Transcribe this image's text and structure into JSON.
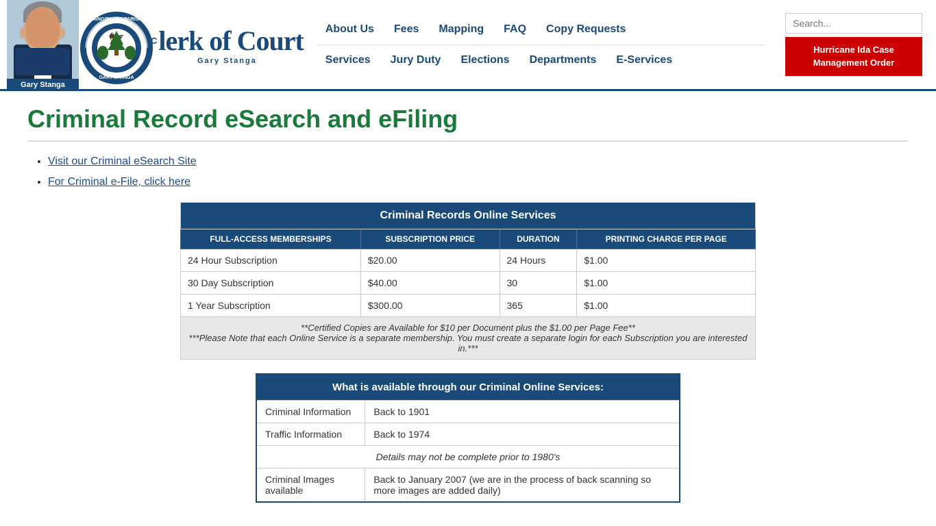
{
  "header": {
    "person_name": "Gary Stanga",
    "seal_text": "TANGIPAHOA\nPARISH",
    "clerk_title": "Clerk of Court",
    "clerk_name": "Gary Stanga",
    "search_placeholder": "Search..."
  },
  "nav": {
    "row1": [
      {
        "label": "About Us",
        "id": "about-us"
      },
      {
        "label": "Fees",
        "id": "fees"
      },
      {
        "label": "Mapping",
        "id": "mapping"
      },
      {
        "label": "FAQ",
        "id": "faq"
      },
      {
        "label": "Copy Requests",
        "id": "copy-requests"
      }
    ],
    "row2": [
      {
        "label": "Services",
        "id": "services"
      },
      {
        "label": "Jury Duty",
        "id": "jury-duty"
      },
      {
        "label": "Elections",
        "id": "elections"
      },
      {
        "label": "Departments",
        "id": "departments"
      },
      {
        "label": "E-Services",
        "id": "e-services"
      }
    ]
  },
  "hurricane_btn": "Hurricane Ida Case Management Order",
  "page": {
    "title": "Criminal Record eSearch and eFiling",
    "links": [
      {
        "label": "Visit our Criminal eSearch Site",
        "id": "esearch-link"
      },
      {
        "label": "For Criminal e-File, click here",
        "id": "efile-link"
      }
    ]
  },
  "records_table": {
    "title": "Criminal Records Online Services",
    "headers": [
      "FULL-ACCESS MEMBERSHIPS",
      "SUBSCRIPTION PRICE",
      "DURATION",
      "PRINTING CHARGE PER PAGE"
    ],
    "rows": [
      [
        "24 Hour Subscription",
        "$20.00",
        "24 Hours",
        "$1.00"
      ],
      [
        "30 Day Subscription",
        "$40.00",
        "30",
        "$1.00"
      ],
      [
        "1 Year Subscription",
        "$300.00",
        "365",
        "$1.00"
      ]
    ],
    "note": "**Certified Copies are Available for $10 per Document plus the $1.00 per Page Fee**\n***Please Note that each Online Service is a separate membership. You must create a separate login for each Subscription you are interested in.***"
  },
  "available_table": {
    "title": "What is available through our Criminal Online Services:",
    "rows": [
      {
        "label": "Criminal Information",
        "value": "Back to 1901"
      },
      {
        "label": "Traffic Information",
        "value": "Back to 1974"
      },
      {
        "label": "",
        "value": "Details may not be complete prior to 1980's",
        "italic": true
      },
      {
        "label": "Criminal Images available",
        "value": "Back to January 2007 (we are in the process of back scanning so more images are added daily)"
      }
    ]
  }
}
